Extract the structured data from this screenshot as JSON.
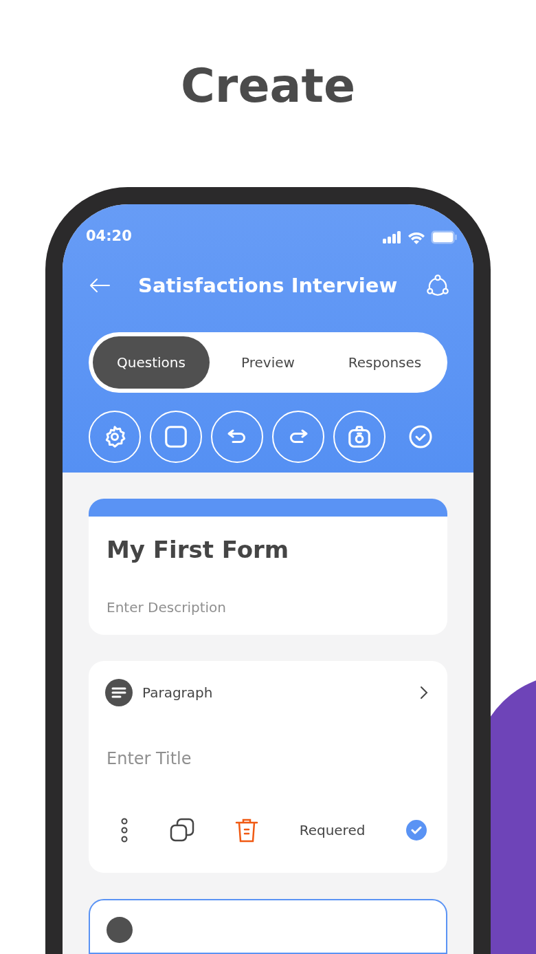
{
  "headline": "Create",
  "status_bar": {
    "time": "04:20"
  },
  "header": {
    "title": "Satisfactions Interview"
  },
  "tabs": [
    {
      "label": "Questions",
      "selected": true
    },
    {
      "label": "Preview",
      "selected": false
    },
    {
      "label": "Responses",
      "selected": false
    }
  ],
  "toolbar": [
    {
      "kind": "settings"
    },
    {
      "kind": "square"
    },
    {
      "kind": "undo"
    },
    {
      "kind": "redo"
    },
    {
      "kind": "camera"
    },
    {
      "kind": "done"
    }
  ],
  "form_header": {
    "title": "My First Form",
    "description_placeholder": "Enter Description"
  },
  "question": {
    "type_label": "Paragraph",
    "title_placeholder": "Enter Title",
    "required_label": "Requered",
    "required": true
  }
}
